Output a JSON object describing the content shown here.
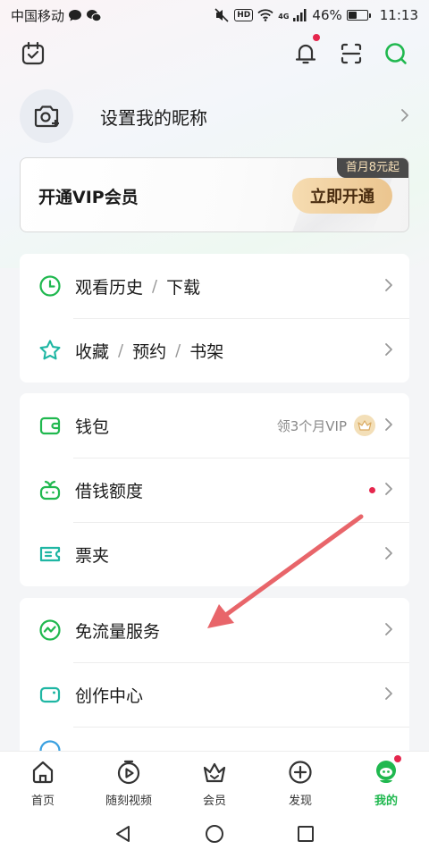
{
  "status_bar": {
    "carrier": "中国移动",
    "signal_type": "4G",
    "battery": "46%",
    "battery_level": 0.46,
    "time": "11:13",
    "hd_label": "HD"
  },
  "profile": {
    "nickname_prompt": "设置我的昵称"
  },
  "vip": {
    "title": "开通VIP会员",
    "button_label": "立即开通",
    "promo_tag": "首月8元起"
  },
  "menu_group_1": {
    "history": "观看历史",
    "download": "下载",
    "favorites": "收藏",
    "reservations": "预约",
    "bookshelf": "书架",
    "separator": "/"
  },
  "menu_group_2": {
    "wallet": "钱包",
    "wallet_hint": "领3个月VIP",
    "loan": "借钱额度",
    "tickets": "票夹"
  },
  "menu_group_3": {
    "free_data": "免流量服务",
    "creator_center": "创作中心"
  },
  "tabbar": {
    "items": [
      {
        "label": "首页",
        "icon": "home-icon"
      },
      {
        "label": "随刻视频",
        "icon": "play-circle-icon"
      },
      {
        "label": "会员",
        "icon": "crown-icon"
      },
      {
        "label": "发现",
        "icon": "plus-circle-icon"
      },
      {
        "label": "我的",
        "icon": "profile-mascot-icon"
      }
    ],
    "active_index": 4
  },
  "colors": {
    "accent_green": "#20b84f",
    "badge_red": "#e5264d",
    "vip_gold": "#ebc58f",
    "annotation_arrow": "#e8656a"
  }
}
